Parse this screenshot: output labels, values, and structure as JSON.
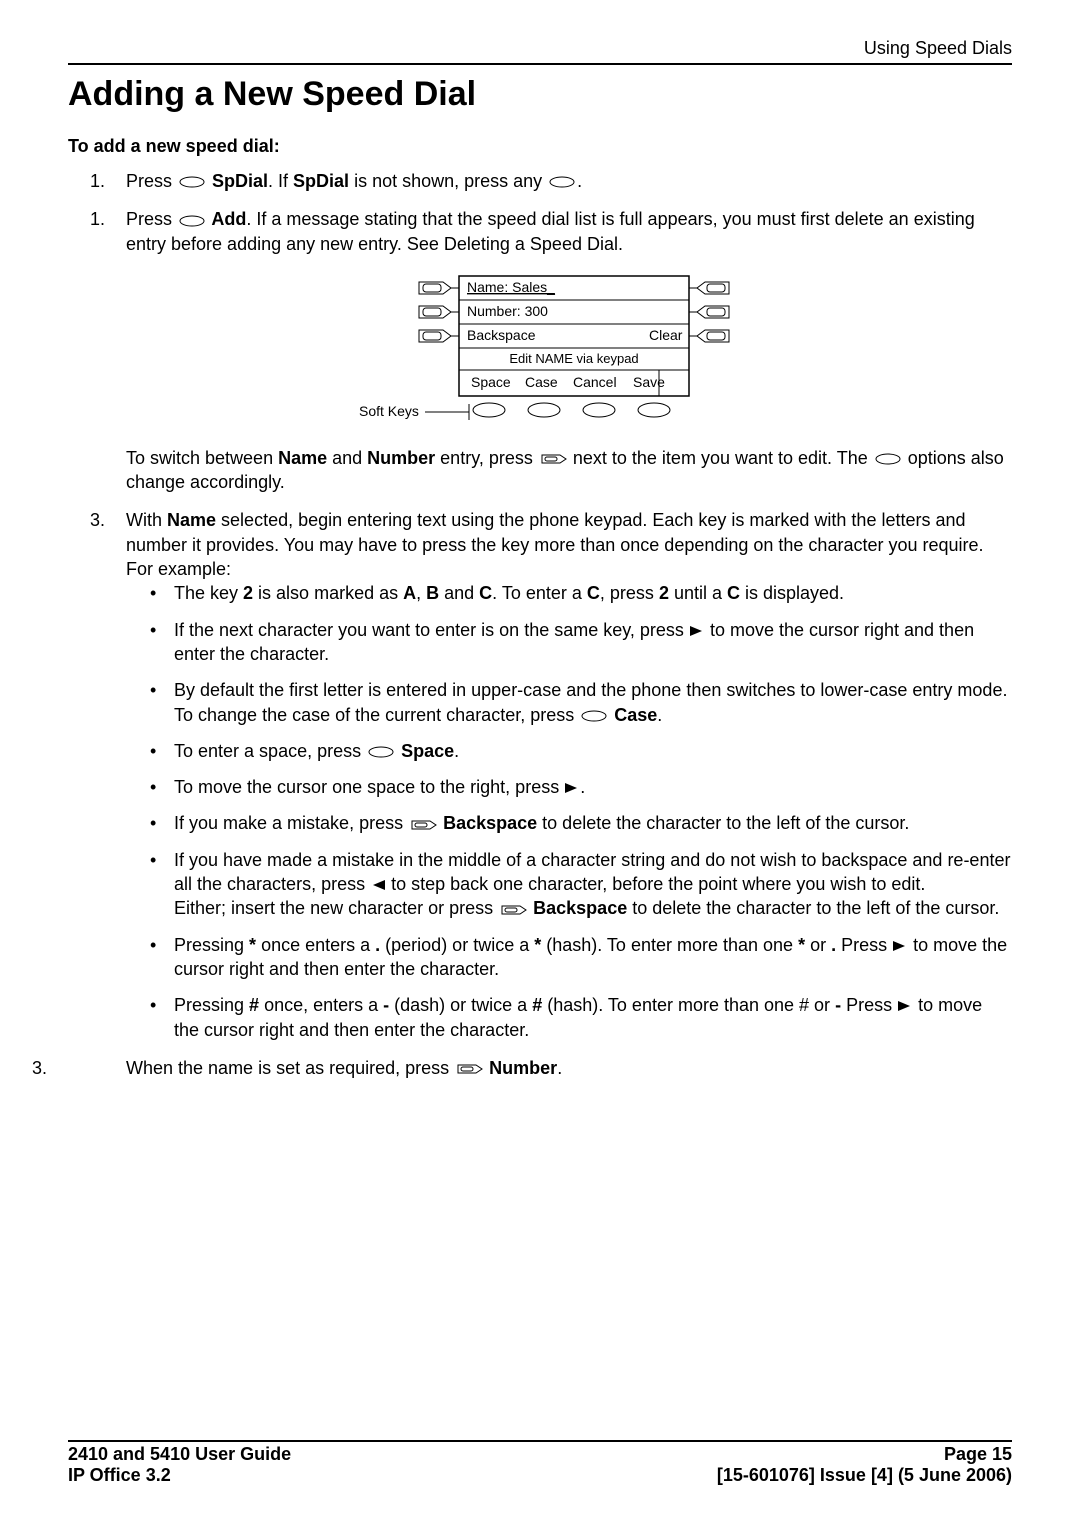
{
  "header": {
    "running": "Using Speed Dials"
  },
  "title": "Adding a New Speed Dial",
  "subhead": "To add a new speed dial:",
  "steps": {
    "s1": {
      "num": "1.",
      "t1": "Press ",
      "btn1": " SpDial",
      "t2": ". If ",
      "btn2": "SpDial",
      "t3": " is not shown, press any ",
      "t4": "."
    },
    "s2": {
      "num": "1.",
      "t1": "Press ",
      "btn": " Add",
      "t2": ". If a message stating that the speed dial list is full appears, you must first delete an existing entry before adding any new entry. See Deleting a Speed Dial."
    },
    "switch": {
      "t1": "To switch between ",
      "name": "Name",
      "t2": " and ",
      "number": "Number",
      "t3": " entry, press ",
      "t4": " next to the item you want to edit. The ",
      "t5": " options also change accordingly."
    },
    "s3": {
      "num": "3.",
      "t1": "With ",
      "name": "Name",
      "t2": " selected, begin entering text using the phone keypad. Each key is marked with the letters and number it provides. You may have to press the key more than once depending on the character you require. For example:"
    },
    "bullets": {
      "b1": {
        "t1": "The key ",
        "k2": "2",
        "t2": " is also marked as ",
        "kA": "A",
        "t3": ", ",
        "kB": "B",
        "t4": " and ",
        "kC": "C",
        "t5": ". To enter a ",
        "kC2": "C",
        "t6": ", press ",
        "k2b": "2",
        "t7": " until a ",
        "kC3": "C",
        "t8": " is displayed."
      },
      "b2": {
        "t1": "If the next character you want to enter is on the same key, press ",
        "t2": " to move the cursor right and then enter the character."
      },
      "b3": {
        "t1": "By default the first letter is entered in upper-case and the phone then switches to lower-case entry mode. To change the case of the current character, press ",
        "btn": " Case",
        "t2": "."
      },
      "b4": {
        "t1": "To enter a space, press ",
        "btn": " Space",
        "t2": "."
      },
      "b5": {
        "t1": "To move the cursor one space to the right, press ",
        "t2": "."
      },
      "b6": {
        "t1": "If you make a mistake, press ",
        "btn": " Backspace",
        "t2": " to delete the character to the left of the cursor."
      },
      "b7": {
        "t1": "If you have made a mistake in the middle of a character string and do not wish to backspace and re-enter all the characters, press ",
        "t2": " to step back one character, before the point where you wish to edit.",
        "t3": "Either; insert the new character or press ",
        "btn": " Backspace",
        "t4": " to delete the character to the left of the cursor."
      },
      "b8": {
        "t1": "Pressing ",
        "star": "*",
        "t2": " once enters a ",
        "period": ".",
        "t3": " (period) or twice a ",
        "star2": "*",
        "t4": " (hash). To enter more than one ",
        "star3": "*",
        "t5": " or ",
        "period2": ".",
        "t6": " Press ",
        "t7": " to move the cursor right and then enter the character."
      },
      "b9": {
        "t1": "Pressing ",
        "hash": "#",
        "t2": " once, enters a ",
        "dash": "-",
        "t3": " (dash) or twice a ",
        "hash2": "#",
        "t4": " (hash). To enter more than one # or ",
        "dash2": "-",
        "t5": " Press ",
        "t6": " to move the cursor right and then enter the character."
      }
    },
    "s3b": {
      "num": "3.",
      "t1": "When the name is set as required, press ",
      "btn": " Number",
      "t2": "."
    }
  },
  "diagram": {
    "name": "Name: Sales_",
    "number": "Number: 300",
    "backspace": "Backspace",
    "clear": "Clear",
    "editmsg": "Edit NAME via keypad",
    "softkeys": [
      "Space",
      "Case",
      "Cancel",
      "Save"
    ],
    "label": "Soft Keys"
  },
  "footer": {
    "l1": "2410 and 5410 User Guide",
    "l2": "IP Office 3.2",
    "r1": "Page 15",
    "r2": "[15-601076] Issue [4] (5 June 2006)"
  }
}
